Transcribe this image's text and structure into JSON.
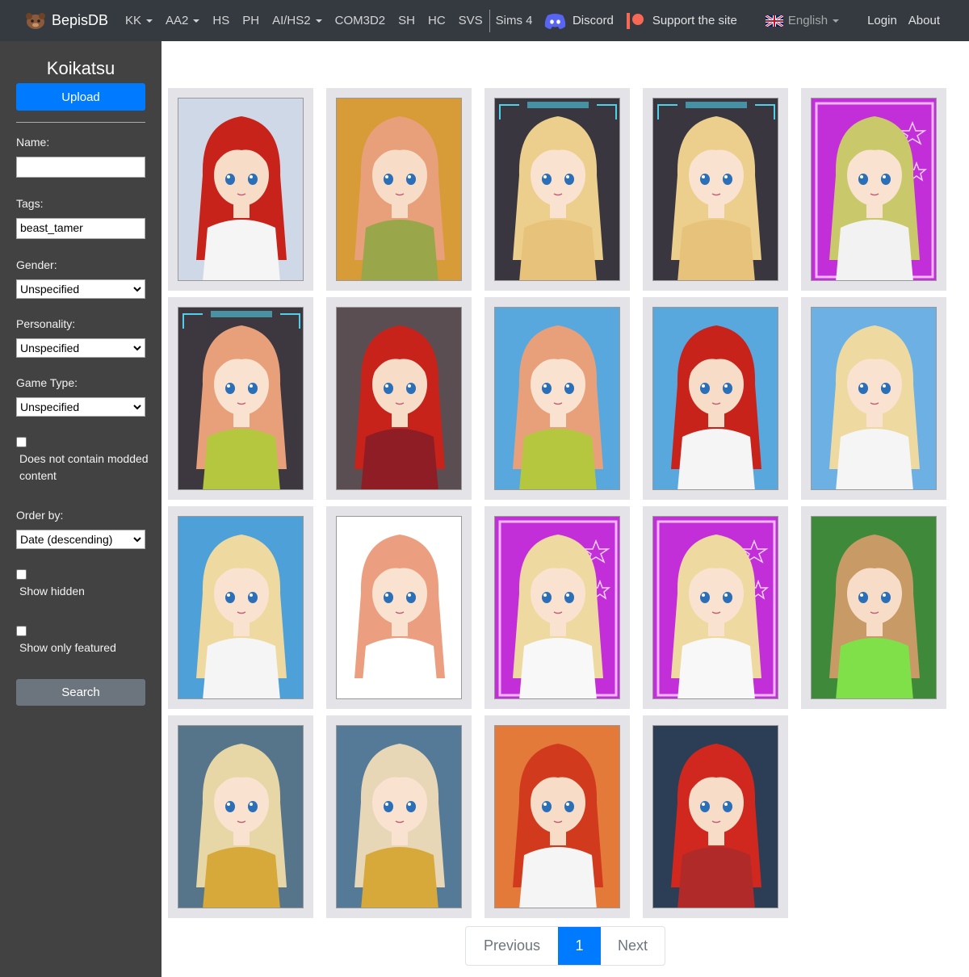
{
  "nav": {
    "brand": "BepisDB",
    "items": [
      {
        "label": "KK",
        "dropdown": true
      },
      {
        "label": "AA2",
        "dropdown": true
      },
      {
        "label": "HS",
        "dropdown": false
      },
      {
        "label": "PH",
        "dropdown": false
      },
      {
        "label": "AI/HS2",
        "dropdown": true
      },
      {
        "label": "COM3D2",
        "dropdown": false
      },
      {
        "label": "SH",
        "dropdown": false
      },
      {
        "label": "HC",
        "dropdown": false
      },
      {
        "label": "SVS",
        "dropdown": false
      }
    ],
    "sims": "Sims 4",
    "discord": "Discord",
    "support": "Support the site",
    "language": "English",
    "login": "Login",
    "about": "About"
  },
  "sidebar": {
    "title": "Koikatsu",
    "upload": "Upload",
    "name_label": "Name:",
    "name_value": "",
    "tags_label": "Tags:",
    "tags_value": "beast_tamer",
    "gender_label": "Gender:",
    "gender_value": "Unspecified",
    "personality_label": "Personality:",
    "personality_value": "Unspecified",
    "game_type_label": "Game Type:",
    "game_type_value": "Unspecified",
    "no_modded_label": "Does not contain modded content",
    "order_label": "Order by:",
    "order_value": "Date (descending)",
    "show_hidden_label": "Show hidden",
    "show_featured_label": "Show only featured",
    "search": "Search"
  },
  "cards": [
    {
      "bg": "#cfd8e6",
      "hair": "#c8231b",
      "skin": "#f7dcc8",
      "outfit": "#f5f5f5",
      "frame": "none"
    },
    {
      "bg": "#d79b38",
      "hair": "#e8a07a",
      "skin": "#f7dcc8",
      "outfit": "#9aa64a",
      "frame": "none"
    },
    {
      "bg": "#3a3640",
      "hair": "#eccf8c",
      "skin": "#f9e2cf",
      "outfit": "#e7c27a",
      "frame": "warblade"
    },
    {
      "bg": "#3a3640",
      "hair": "#eccf8c",
      "skin": "#f9e2cf",
      "outfit": "#e7c27a",
      "frame": "warblade"
    },
    {
      "bg": "#c22ed8",
      "hair": "#c9c86a",
      "skin": "#f9e2cf",
      "outfit": "#f2f2f2",
      "frame": "koikatsu"
    },
    {
      "bg": "#3d3740",
      "hair": "#e8a07a",
      "skin": "#f9e2cf",
      "outfit": "#b5c73e",
      "frame": "warblade"
    },
    {
      "bg": "#5a4e52",
      "hair": "#c8231b",
      "skin": "#f7dcc8",
      "outfit": "#8f1d26",
      "frame": "none"
    },
    {
      "bg": "#58a8de",
      "hair": "#e8a07a",
      "skin": "#f9e2cf",
      "outfit": "#b5c73e",
      "frame": "none"
    },
    {
      "bg": "#58a8de",
      "hair": "#c8231b",
      "skin": "#f7dcc8",
      "outfit": "#f5f5f5",
      "frame": "none"
    },
    {
      "bg": "#6db0e4",
      "hair": "#eed9a0",
      "skin": "#f9e2cf",
      "outfit": "#f5f5f5",
      "frame": "none"
    },
    {
      "bg": "#4ea0d8",
      "hair": "#eed9a0",
      "skin": "#f9e2cf",
      "outfit": "#f5f5f5",
      "frame": "none"
    },
    {
      "bg": "#ffffff",
      "hair": "#ec9f80",
      "skin": "#f9e2cf",
      "outfit": "#ffffff",
      "frame": "none"
    },
    {
      "bg": "#c22ed8",
      "hair": "#eed9a0",
      "skin": "#f9e2cf",
      "outfit": "#f8f8f8",
      "frame": "koikatsu"
    },
    {
      "bg": "#c22ed8",
      "hair": "#eed9a0",
      "skin": "#f9e2cf",
      "outfit": "#f8f8f8",
      "frame": "koikatsu"
    },
    {
      "bg": "#3f8a3a",
      "hair": "#c89a66",
      "skin": "#f7dcc8",
      "outfit": "#7fe04a",
      "frame": "none"
    },
    {
      "bg": "#57758a",
      "hair": "#e8d7a6",
      "skin": "#f9e2cf",
      "outfit": "#d6a93a",
      "frame": "none"
    },
    {
      "bg": "#557a98",
      "hair": "#e8d7b6",
      "skin": "#f9e2cf",
      "outfit": "#d6a93a",
      "frame": "none"
    },
    {
      "bg": "#e37a3a",
      "hair": "#d23a1e",
      "skin": "#f7dcc8",
      "outfit": "#f5f5f5",
      "frame": "none"
    },
    {
      "bg": "#2b3e55",
      "hair": "#d0281e",
      "skin": "#f7dcc8",
      "outfit": "#b02a2a",
      "frame": "none"
    }
  ],
  "pagination": {
    "previous": "Previous",
    "current": "1",
    "next": "Next"
  }
}
